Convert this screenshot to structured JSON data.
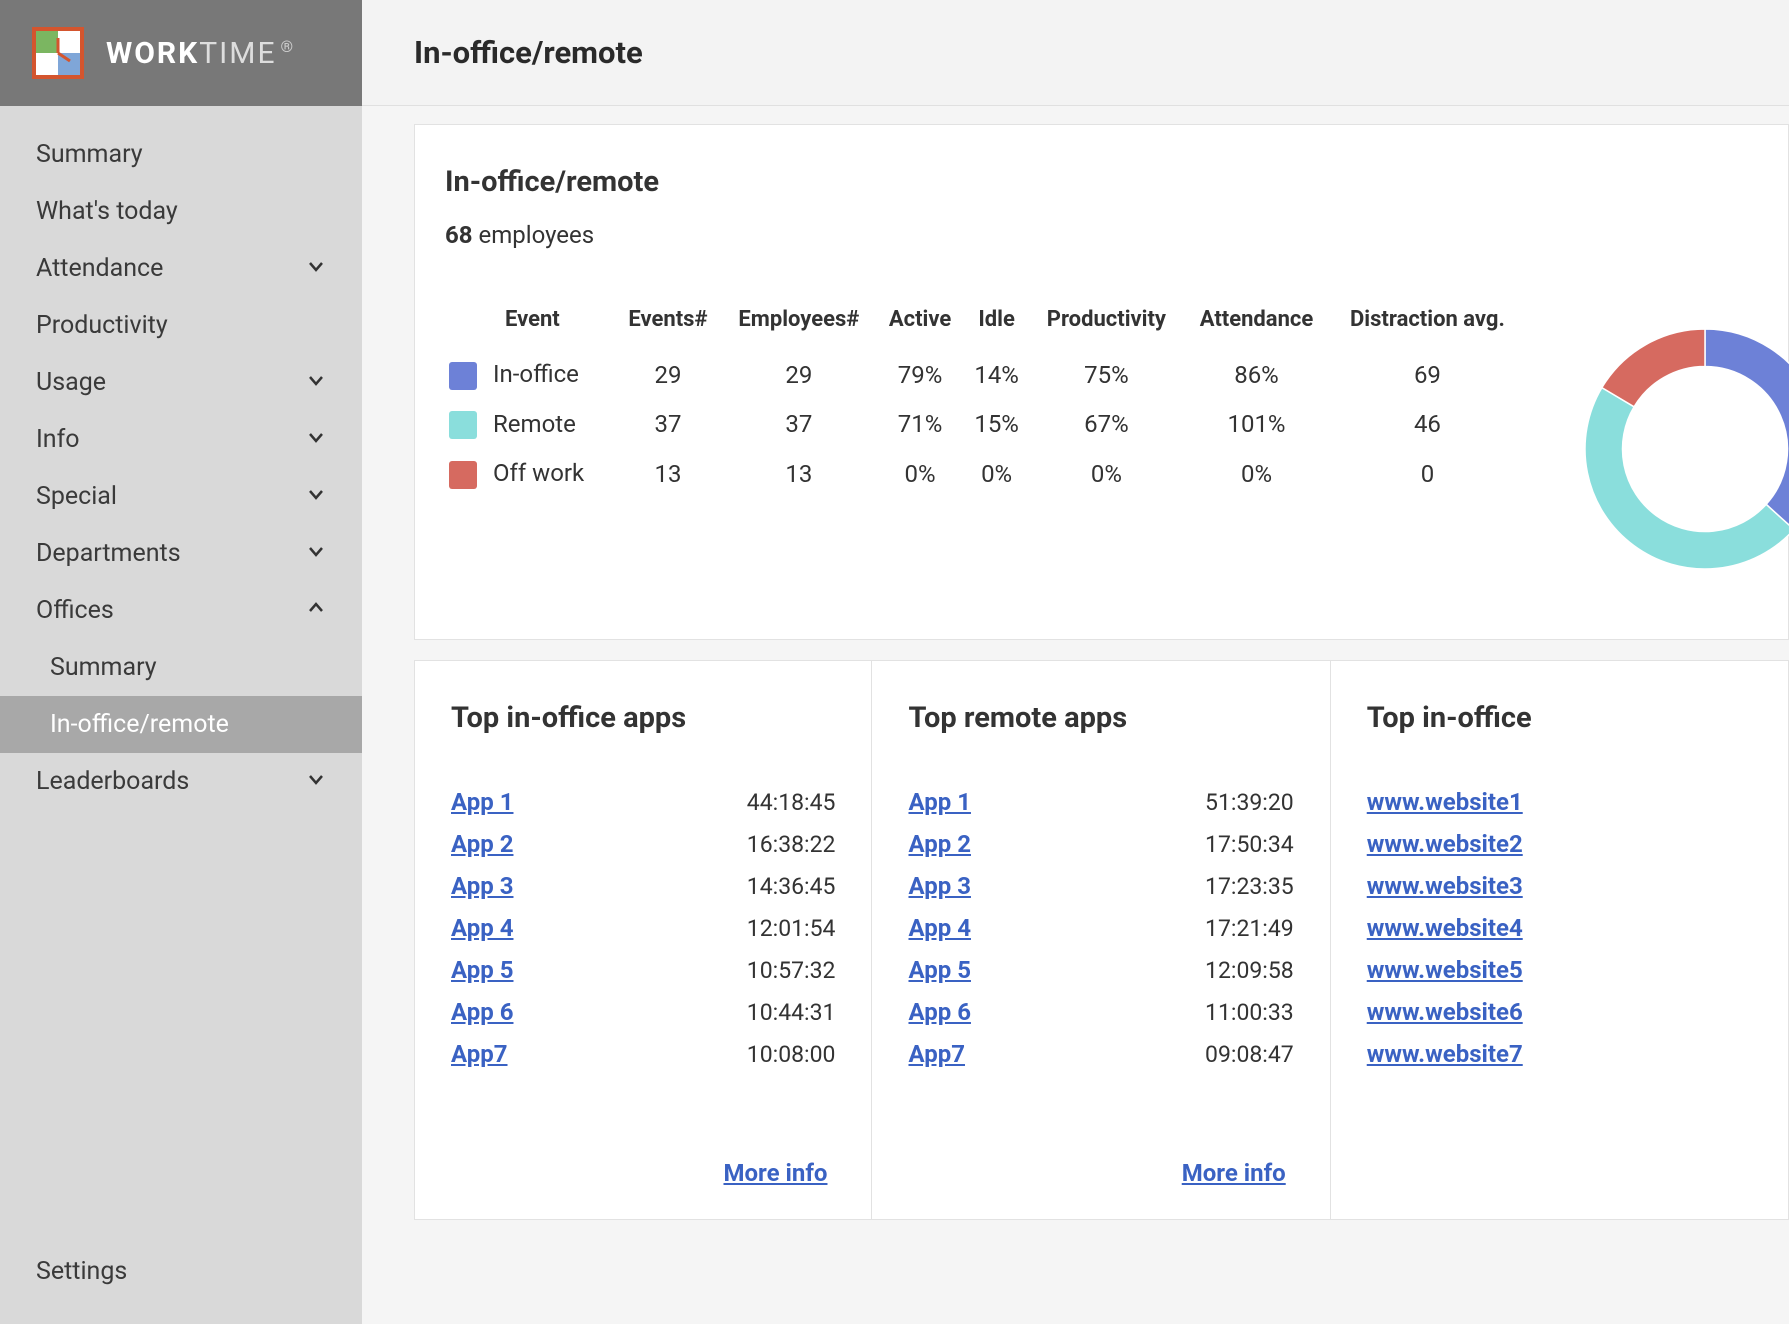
{
  "brand": {
    "strong": "WORK",
    "light": "TIME",
    "reg": "®"
  },
  "nav": {
    "items": [
      {
        "label": "Summary",
        "expandable": false
      },
      {
        "label": "What's today",
        "expandable": false
      },
      {
        "label": "Attendance",
        "expandable": true,
        "open": false
      },
      {
        "label": "Productivity",
        "expandable": false
      },
      {
        "label": "Usage",
        "expandable": true,
        "open": false
      },
      {
        "label": "Info",
        "expandable": true,
        "open": false
      },
      {
        "label": "Special",
        "expandable": true,
        "open": false
      },
      {
        "label": "Departments",
        "expandable": true,
        "open": false
      },
      {
        "label": "Offices",
        "expandable": true,
        "open": true,
        "children": [
          {
            "label": "Summary",
            "active": false
          },
          {
            "label": "In-office/remote",
            "active": true
          }
        ]
      },
      {
        "label": "Leaderboards",
        "expandable": true,
        "open": false
      }
    ],
    "settings": "Settings"
  },
  "header": {
    "title": "In-office/remote"
  },
  "main": {
    "title": "In-office/remote",
    "employees_count": "68",
    "employees_label": "employees",
    "table": {
      "headers": [
        "Event",
        "Events#",
        "Employees#",
        "Active",
        "Idle",
        "Productivity",
        "Attendance",
        "Distraction avg."
      ],
      "rows": [
        {
          "color": "#6d81d7",
          "event": "In-office",
          "events": "29",
          "employees": "29",
          "active": "79%",
          "idle": "14%",
          "productivity": "75%",
          "attendance": "86%",
          "distraction": "69"
        },
        {
          "color": "#8adedc",
          "event": "Remote",
          "events": "37",
          "employees": "37",
          "active": "71%",
          "idle": "15%",
          "productivity": "67%",
          "attendance": "101%",
          "distraction": "46"
        },
        {
          "color": "#d66a60",
          "event": "Off work",
          "events": "13",
          "employees": "13",
          "active": "0%",
          "idle": "0%",
          "productivity": "0%",
          "attendance": "0%",
          "distraction": "0"
        }
      ]
    }
  },
  "chart_data": {
    "type": "pie",
    "hole": 0.55,
    "series": [
      {
        "name": "In-office",
        "value": 29,
        "color": "#6d81d7"
      },
      {
        "name": "Remote",
        "value": 37,
        "color": "#8adedc"
      },
      {
        "name": "Off work",
        "value": 13,
        "color": "#d66a60"
      }
    ]
  },
  "cards": [
    {
      "title": "Top in-office apps",
      "items": [
        {
          "name": "App  1",
          "time": "44:18:45"
        },
        {
          "name": "App  2",
          "time": "16:38:22"
        },
        {
          "name": "App  3",
          "time": "14:36:45"
        },
        {
          "name": "App  4",
          "time": "12:01:54"
        },
        {
          "name": "App  5",
          "time": "10:57:32"
        },
        {
          "name": "App  6",
          "time": "10:44:31"
        },
        {
          "name": "App7",
          "time": "10:08:00"
        }
      ],
      "more": "More info"
    },
    {
      "title": "Top remote apps",
      "items": [
        {
          "name": "App  1",
          "time": "51:39:20"
        },
        {
          "name": "App  2",
          "time": "17:50:34"
        },
        {
          "name": "App  3",
          "time": "17:23:35"
        },
        {
          "name": "App  4",
          "time": "17:21:49"
        },
        {
          "name": "App  5",
          "time": "12:09:58"
        },
        {
          "name": "App  6",
          "time": "11:00:33"
        },
        {
          "name": "App7",
          "time": "09:08:47"
        }
      ],
      "more": "More info"
    },
    {
      "title": "Top in-office",
      "items": [
        {
          "name": "www.website1"
        },
        {
          "name": "www.website2"
        },
        {
          "name": "www.website3"
        },
        {
          "name": "www.website4"
        },
        {
          "name": "www.website5"
        },
        {
          "name": "www.website6"
        },
        {
          "name": "www.website7"
        }
      ]
    }
  ]
}
